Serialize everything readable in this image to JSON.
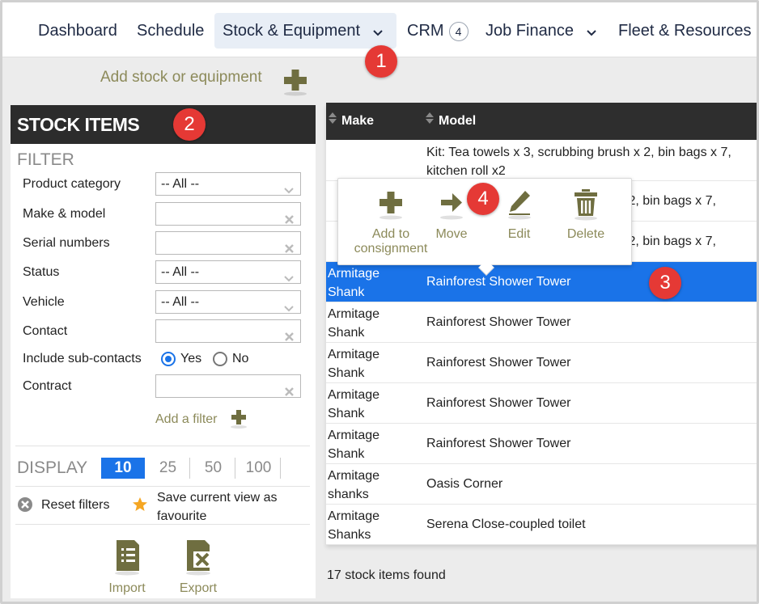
{
  "nav": {
    "items": [
      {
        "label": "Dashboard"
      },
      {
        "label": "Schedule"
      },
      {
        "label": "Stock & Equipment"
      },
      {
        "label": "CRM",
        "badge": "4"
      },
      {
        "label": "Job Finance"
      },
      {
        "label": "Fleet & Resources"
      }
    ]
  },
  "callouts": [
    "1",
    "2",
    "3",
    "4"
  ],
  "add_stock_label": "Add stock or equipment",
  "panel": {
    "title": "STOCK ITEMS",
    "filter_title": "FILTER",
    "filters": [
      {
        "label": "Product category",
        "value": "-- All --",
        "type": "select"
      },
      {
        "label": "Make & model",
        "value": "",
        "type": "text"
      },
      {
        "label": "Serial numbers",
        "value": "",
        "type": "text"
      },
      {
        "label": "Status",
        "value": "-- All --",
        "type": "select"
      },
      {
        "label": "Vehicle",
        "value": "-- All --",
        "type": "select"
      },
      {
        "label": "Contact",
        "value": "",
        "type": "text"
      },
      {
        "label": "Include sub-contacts",
        "type": "radio",
        "options": [
          "Yes",
          "No"
        ],
        "selected": "Yes"
      },
      {
        "label": "Contract",
        "value": "",
        "type": "text"
      }
    ],
    "add_filter_label": "Add a filter",
    "display_label": "DISPLAY",
    "page_sizes": [
      "10",
      "25",
      "50",
      "100"
    ],
    "selected_page_size": "10",
    "reset_filters_label": "Reset filters",
    "save_view_label": "Save current view as favourite",
    "import_label": "Import",
    "export_label": "Export"
  },
  "table": {
    "columns": [
      "Make",
      "Model"
    ],
    "rows": [
      {
        "make": "",
        "model": "Kit: Tea towels x 3, scrubbing brush x 2, bin bags x 7, kitchen roll x2"
      },
      {
        "make": "",
        "model": "x 2, bin bags x 7,"
      },
      {
        "make": "",
        "model": "x 2, bin bags x 7,"
      },
      {
        "make": "Armitage Shank",
        "model": "Rainforest Shower Tower",
        "selected": true
      },
      {
        "make": "Armitage Shank",
        "model": "Rainforest Shower Tower"
      },
      {
        "make": "Armitage Shank",
        "model": "Rainforest Shower Tower"
      },
      {
        "make": "Armitage Shank",
        "model": "Rainforest Shower Tower"
      },
      {
        "make": "Armitage Shank",
        "model": "Rainforest Shower Tower"
      },
      {
        "make": "Armitage shanks",
        "model": "Oasis Corner"
      },
      {
        "make": "Armitage Shanks",
        "model": "Serena Close-coupled toilet"
      }
    ],
    "found_text": "17 stock items found"
  },
  "popup": {
    "actions": [
      {
        "label": "Add to consignment",
        "icon": "plus-icon"
      },
      {
        "label": "Move",
        "icon": "arrow-right-icon"
      },
      {
        "label": "Edit",
        "icon": "pencil-icon"
      },
      {
        "label": "Delete",
        "icon": "trash-icon"
      }
    ]
  },
  "colors": {
    "accent": "#1a73e8",
    "header_dark": "#2c2c2c",
    "callout_red": "#e53935",
    "olive": "#6f6e40"
  }
}
